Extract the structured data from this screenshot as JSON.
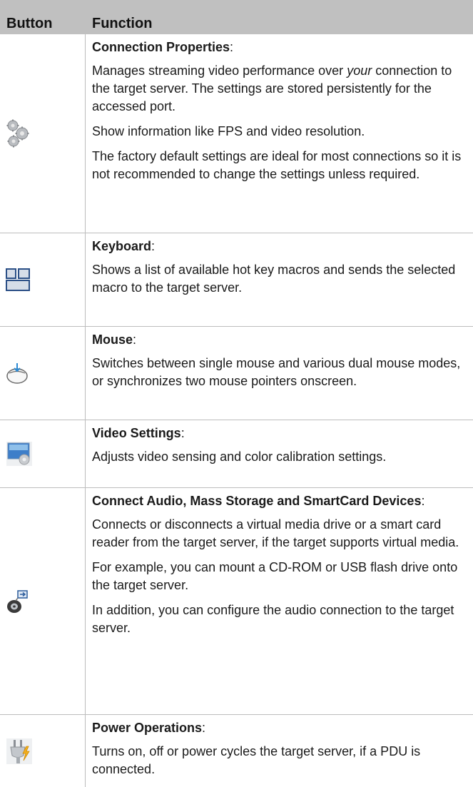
{
  "header": {
    "button_col": "Button",
    "function_col": "Function"
  },
  "rows": [
    {
      "icon": "gears-icon",
      "title": "Connection Properties",
      "title_suffix": ":",
      "para1_pre": "Manages streaming video performance over ",
      "para1_em": "your",
      "para1_post": " connection to the target server. The settings are stored persistently for the accessed port.",
      "para2": "Show information like FPS and video resolution.",
      "para3": "The factory default settings are ideal for most connections so it is not recommended to change the settings unless required."
    },
    {
      "icon": "keyboard-icon",
      "title": "Keyboard",
      "title_suffix": ":",
      "para1": "Shows a list of available hot key macros and sends the selected macro to the target server."
    },
    {
      "icon": "mouse-icon",
      "title": "Mouse",
      "title_suffix": ":",
      "para1": "Switches between single mouse and various dual mouse modes, or synchronizes two mouse pointers onscreen."
    },
    {
      "icon": "video-settings-icon",
      "title": "Video Settings",
      "title_suffix": ":",
      "para1": "Adjusts video sensing and color calibration settings."
    },
    {
      "icon": "media-devices-icon",
      "title": "Connect Audio, Mass Storage and SmartCard Devices",
      "title_suffix": ":",
      "para1": "Connects or disconnects a virtual media drive or a smart card reader from the target server, if the target supports virtual media.",
      "para2": "For example, you can mount a CD-ROM or USB flash drive onto the target server.",
      "para3": "In addition, you can configure the audio connection to the target server."
    },
    {
      "icon": "power-plug-icon",
      "title": "Power Operations",
      "title_suffix": ":",
      "para1": "Turns on, off or power cycles the target server, if a PDU is connected."
    }
  ]
}
